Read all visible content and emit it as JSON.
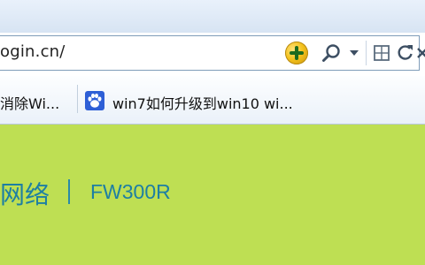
{
  "address_bar": {
    "url_text": "ogin.cn/"
  },
  "favorites_bar": {
    "items": [
      {
        "label": "消除Wi..."
      },
      {
        "label": "win7如何升级到win10 wi..."
      }
    ]
  },
  "page": {
    "brand_text": "网络",
    "model_text": "FW300R",
    "background_color": "#bedf53",
    "text_color": "#1d7fa3"
  }
}
